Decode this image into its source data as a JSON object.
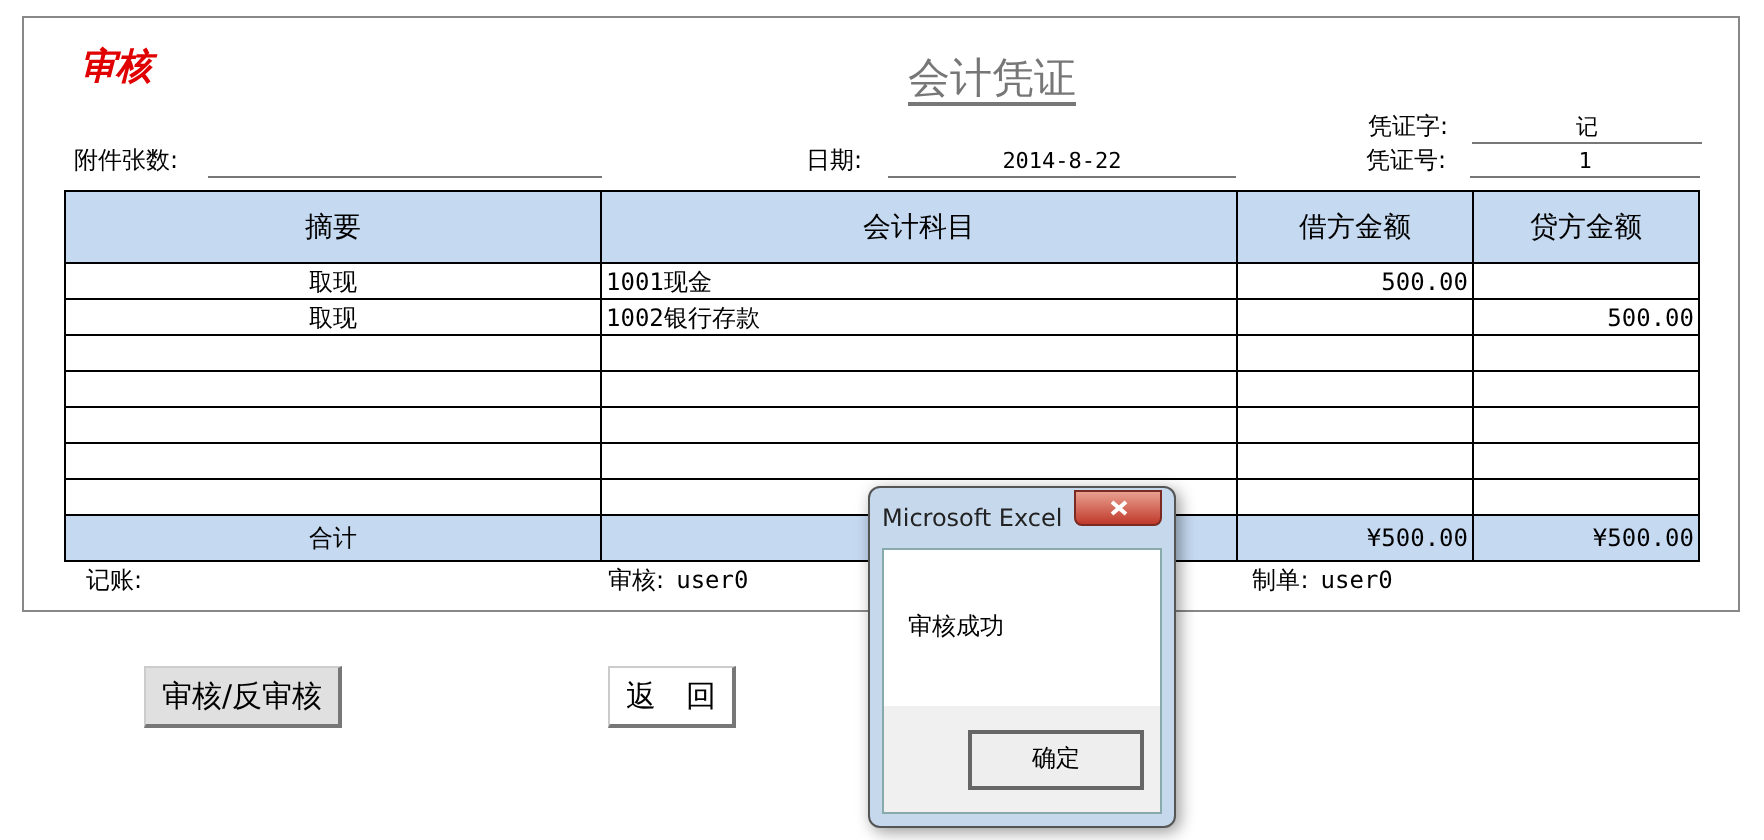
{
  "stamp": "审核",
  "title": "会计凭证",
  "voucher_type": {
    "label": "凭证字:",
    "value": "记"
  },
  "voucher_no": {
    "label": "凭证号:",
    "value": "1"
  },
  "attachments": {
    "label": "附件张数:"
  },
  "date": {
    "label": "日期:",
    "value": "2014-8-22"
  },
  "table": {
    "columns": [
      "摘要",
      "会计科目",
      "借方金额",
      "贷方金额"
    ],
    "rows": [
      {
        "summary": "取现",
        "account": "1001现金",
        "debit": "500.00"
      },
      {
        "summary": "取现",
        "account": "1002银行存款",
        "credit": "500.00"
      },
      {},
      {},
      {},
      {},
      {}
    ],
    "total": {
      "label": "合计",
      "debit": "¥500.00",
      "credit": "¥500.00"
    }
  },
  "footer": [
    {
      "label": "记账:"
    },
    {
      "label": "审核:",
      "value": "user0"
    },
    {
      "label": "制单:",
      "value": "user0"
    }
  ],
  "buttons": [
    {
      "label": "审核/反审核",
      "kind": "grey"
    },
    {
      "label": "返　回",
      "kind": "white"
    }
  ],
  "dialog": {
    "title": "Microsoft Excel",
    "message": "审核成功",
    "button": "确定"
  }
}
